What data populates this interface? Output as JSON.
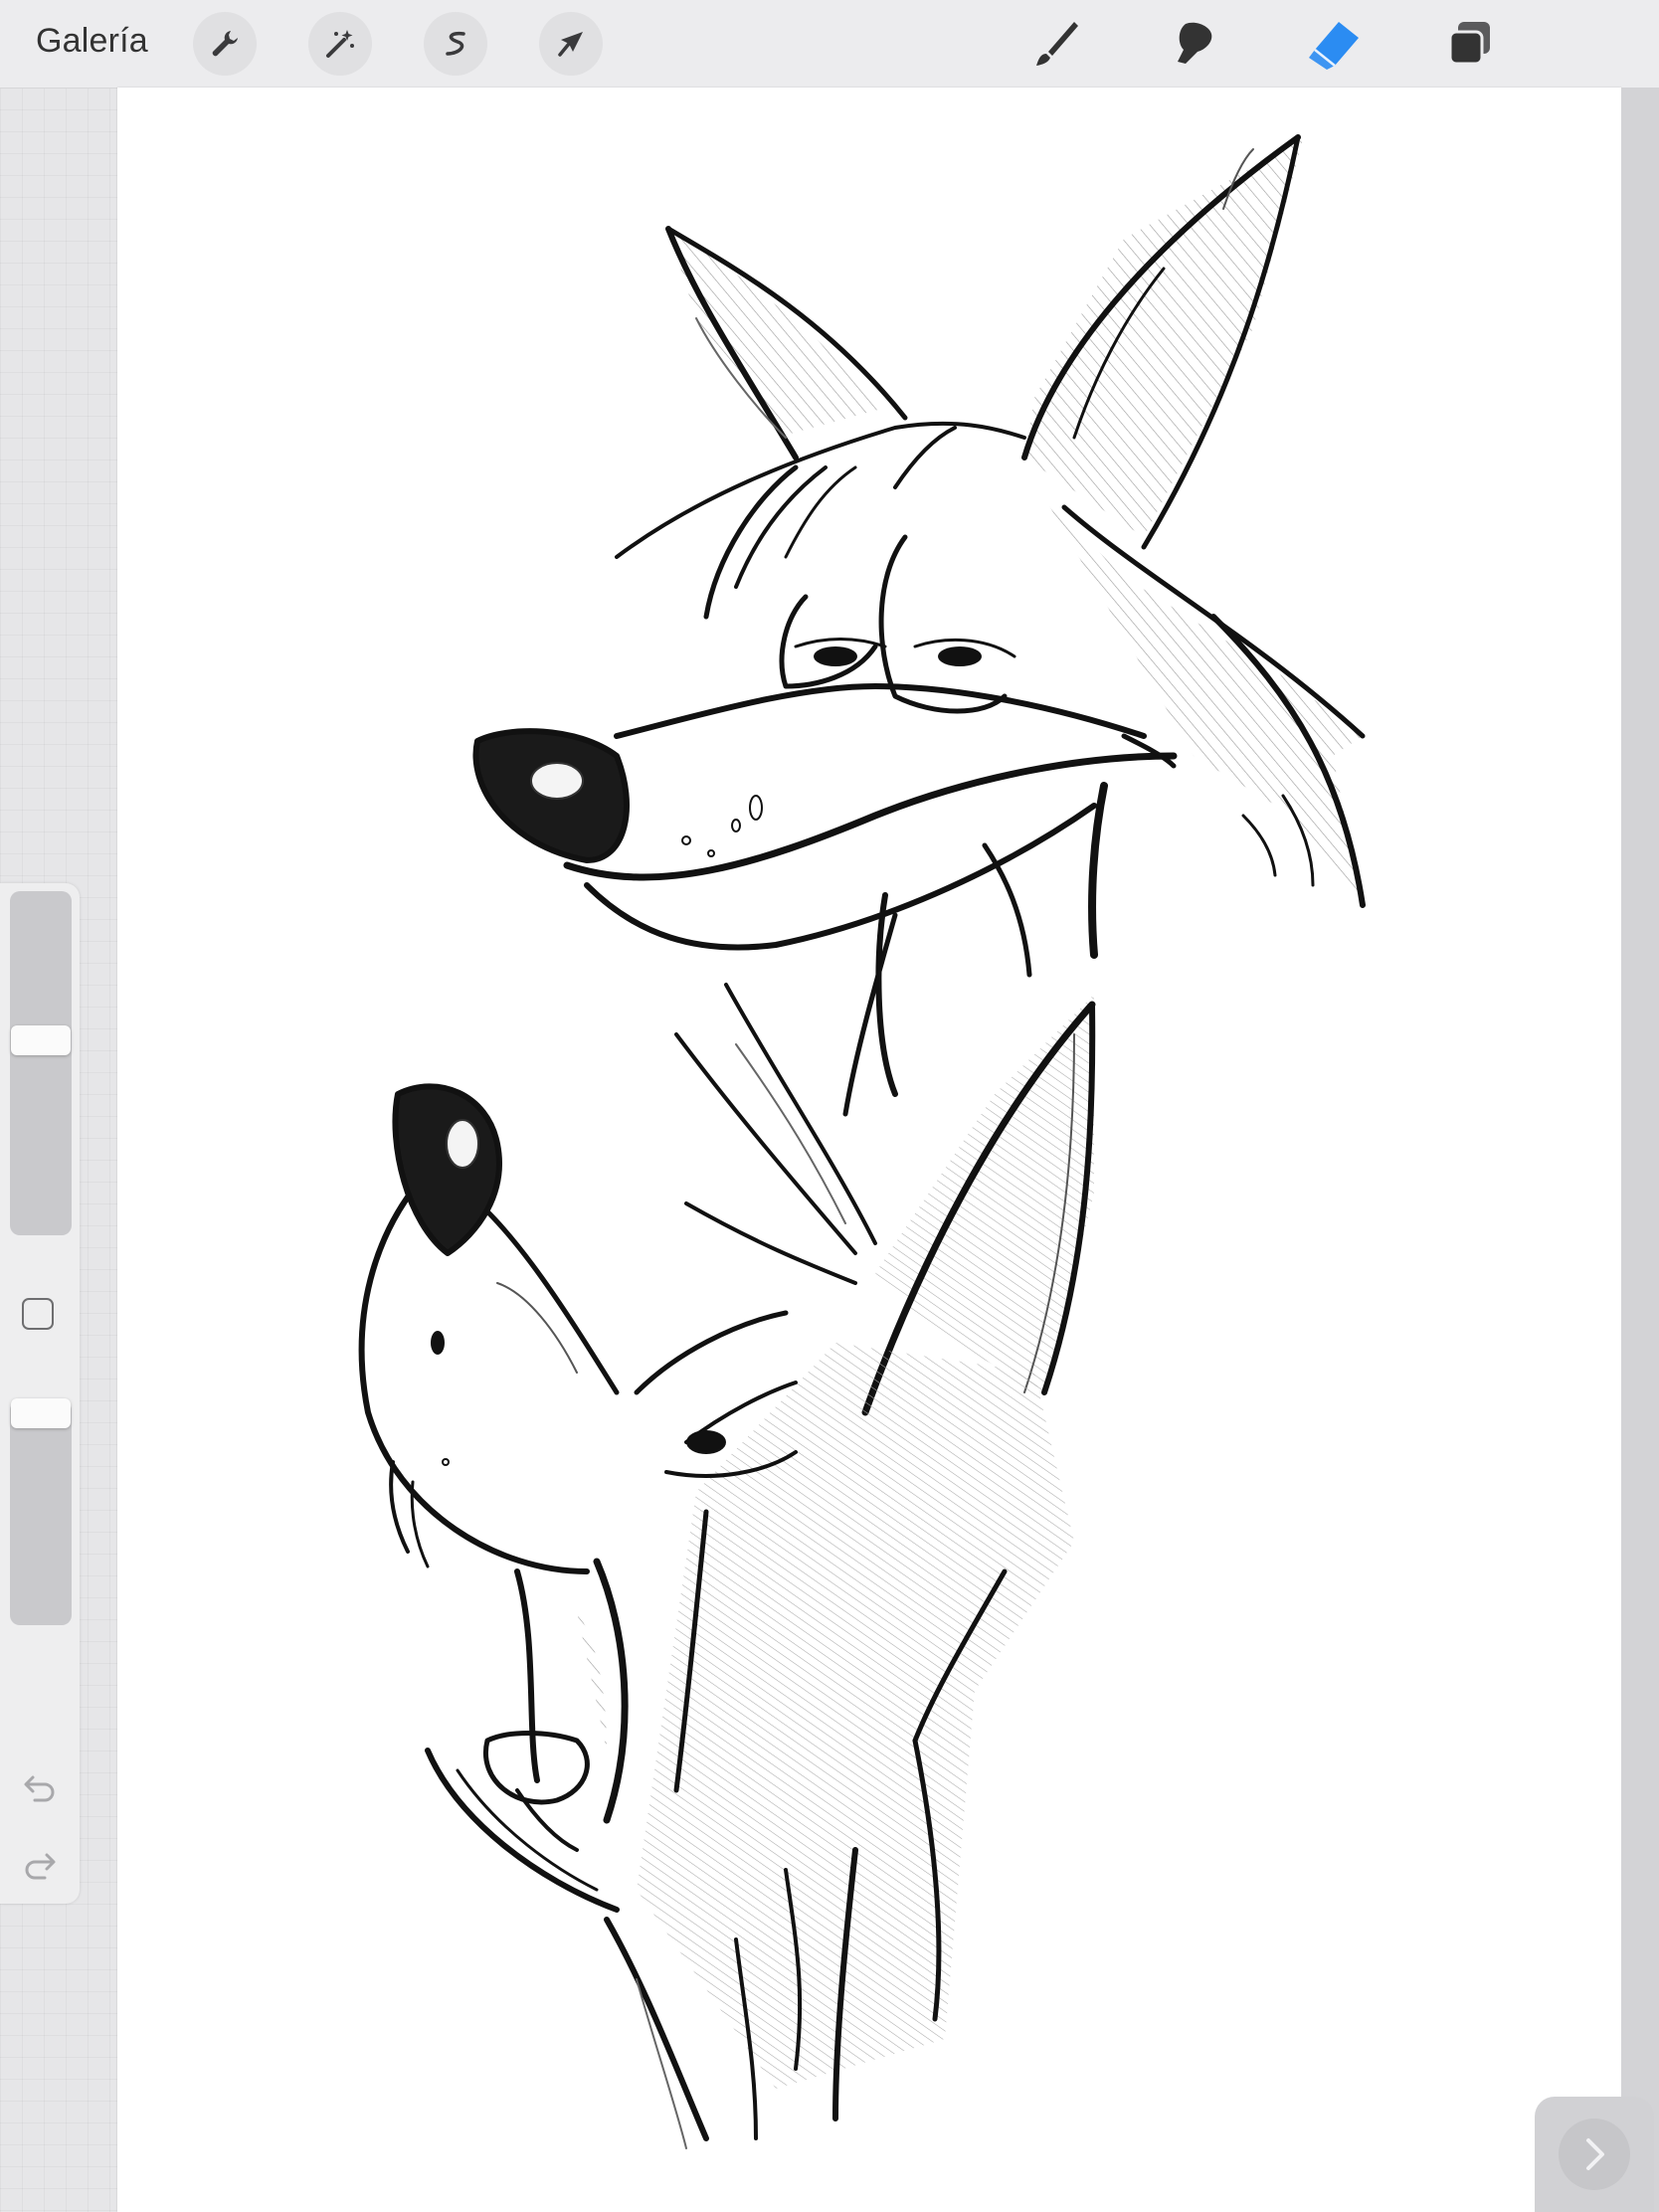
{
  "toolbar": {
    "gallery_label": "Galería",
    "actions": [
      {
        "name": "wrench-icon"
      },
      {
        "name": "magic-wand-icon"
      },
      {
        "name": "selection-s-icon"
      },
      {
        "name": "transform-arrow-icon"
      }
    ],
    "tools": [
      {
        "name": "brush-icon"
      },
      {
        "name": "smudge-icon"
      },
      {
        "name": "eraser-icon",
        "active": true
      },
      {
        "name": "layers-icon"
      }
    ]
  },
  "colors": {
    "active_tool": "#2b8cf2",
    "toolbar_bg": "#ececee",
    "canvas_bg": "#ffffff",
    "ink": "#111111"
  },
  "sidebar": {
    "brush_size": 0.55,
    "opacity": 1.0
  }
}
